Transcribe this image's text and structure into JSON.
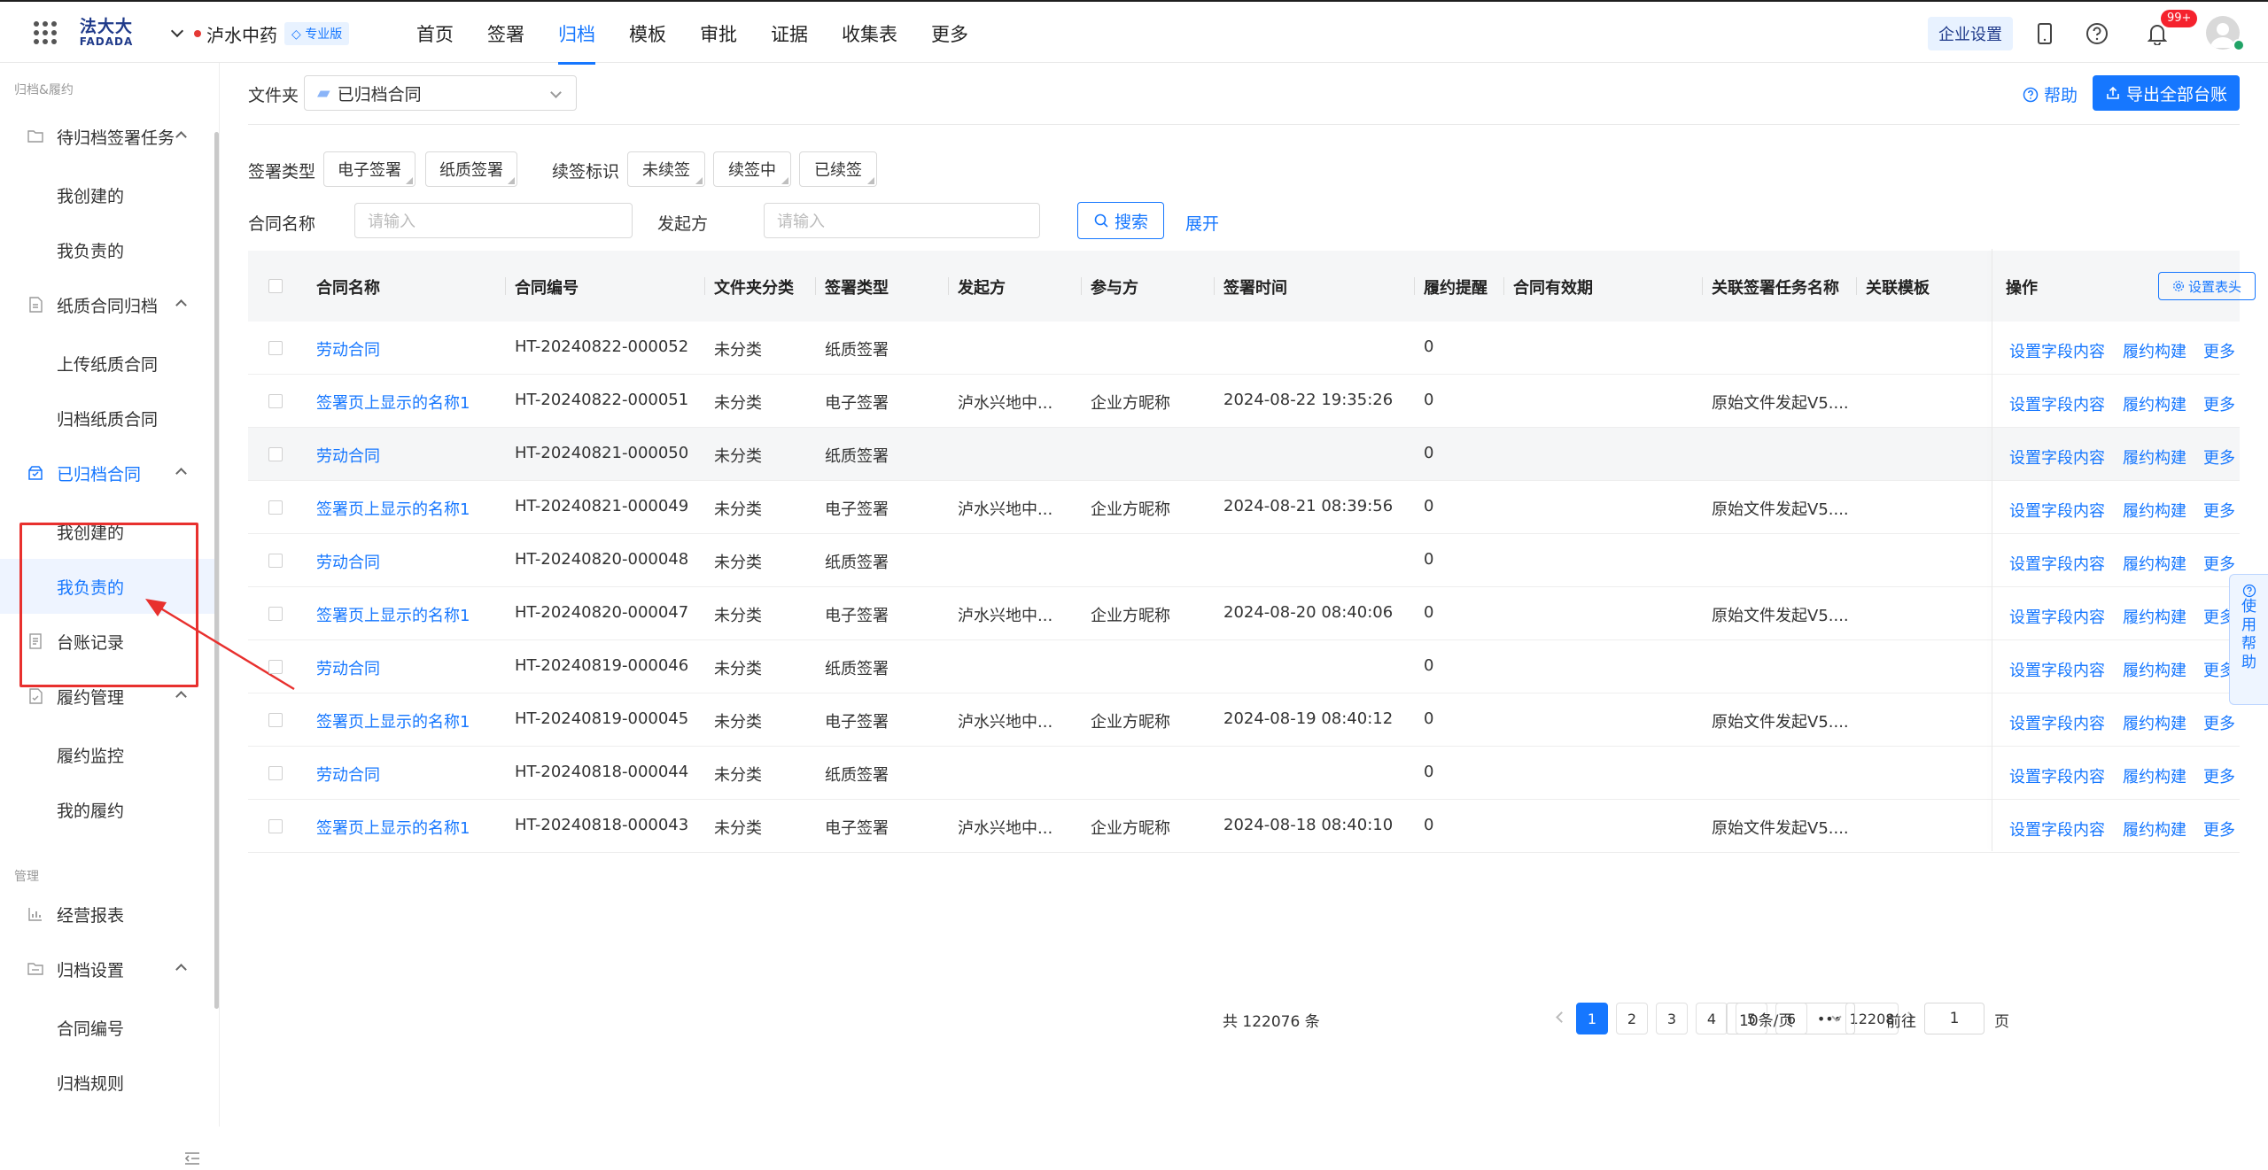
{
  "topbar": {
    "logo_line1": "法大大",
    "logo_line2": "FADADA",
    "org_name": "泸水中药",
    "org_badge": "专业版",
    "nav": [
      "首页",
      "签署",
      "归档",
      "模板",
      "审批",
      "证据",
      "收集表",
      "更多"
    ],
    "active_nav": "归档",
    "enterprise_settings": "企业设置",
    "notification_count": "99+"
  },
  "sidebar": {
    "section1": "归档&履约",
    "items": [
      {
        "label": "待归档签署任务",
        "type": "group",
        "icon": "folder-icon"
      },
      {
        "label": "我创建的",
        "type": "sub"
      },
      {
        "label": "我负责的",
        "type": "sub"
      },
      {
        "label": "纸质合同归档",
        "type": "group",
        "icon": "paper-icon"
      },
      {
        "label": "上传纸质合同",
        "type": "sub"
      },
      {
        "label": "归档纸质合同",
        "type": "sub"
      },
      {
        "label": "已归档合同",
        "type": "group",
        "icon": "archive-box-icon"
      },
      {
        "label": "我创建的",
        "type": "sub"
      },
      {
        "label": "我负责的",
        "type": "sub"
      },
      {
        "label": "台账记录",
        "type": "single",
        "icon": "ledger-icon"
      },
      {
        "label": "履约管理",
        "type": "group",
        "icon": "performance-icon"
      },
      {
        "label": "履约监控",
        "type": "sub"
      },
      {
        "label": "我的履约",
        "type": "sub"
      }
    ],
    "section2": "管理",
    "items2": [
      {
        "label": "经营报表",
        "type": "single",
        "icon": "chart-icon"
      },
      {
        "label": "归档设置",
        "type": "group",
        "icon": "settings-folder-icon"
      },
      {
        "label": "合同编号",
        "type": "sub"
      },
      {
        "label": "归档规则",
        "type": "sub"
      }
    ]
  },
  "toolbar": {
    "folder_label": "文件夹",
    "folder_value": "已归档合同",
    "help": "帮助",
    "export": "导出全部台账"
  },
  "filters": {
    "sign_type_label": "签署类型",
    "sign_types": [
      "电子签署",
      "纸质签署"
    ],
    "renew_label": "续签标识",
    "renew_tags": [
      "未续签",
      "续签中",
      "已续签"
    ],
    "contract_name_label": "合同名称",
    "contract_name_placeholder": "请输入",
    "initiator_label": "发起方",
    "initiator_placeholder": "请输入",
    "search": "搜索",
    "expand": "展开"
  },
  "table": {
    "columns": [
      "合同名称",
      "合同编号",
      "文件夹分类",
      "签署类型",
      "发起方",
      "参与方",
      "签署时间",
      "履约提醒",
      "合同有效期",
      "关联签署任务名称",
      "关联模板"
    ],
    "op_column": "操作",
    "set_columns": "设置表头",
    "ops": [
      "设置字段内容",
      "履约构建",
      "更多"
    ],
    "rows": [
      [
        "劳动合同",
        "HT-20240822-000052",
        "未分类",
        "纸质签署",
        "",
        "",
        "",
        "0",
        "",
        "",
        ""
      ],
      [
        "签署页上显示的名称1",
        "HT-20240822-000051",
        "未分类",
        "电子签署",
        "泸水兴地中...",
        "企业方昵称",
        "2024-08-22 19:35:26",
        "0",
        "",
        "原始文件发起V5....",
        ""
      ],
      [
        "劳动合同",
        "HT-20240821-000050",
        "未分类",
        "纸质签署",
        "",
        "",
        "",
        "0",
        "",
        "",
        ""
      ],
      [
        "签署页上显示的名称1",
        "HT-20240821-000049",
        "未分类",
        "电子签署",
        "泸水兴地中...",
        "企业方昵称",
        "2024-08-21 08:39:56",
        "0",
        "",
        "原始文件发起V5....",
        ""
      ],
      [
        "劳动合同",
        "HT-20240820-000048",
        "未分类",
        "纸质签署",
        "",
        "",
        "",
        "0",
        "",
        "",
        ""
      ],
      [
        "签署页上显示的名称1",
        "HT-20240820-000047",
        "未分类",
        "电子签署",
        "泸水兴地中...",
        "企业方昵称",
        "2024-08-20 08:40:06",
        "0",
        "",
        "原始文件发起V5....",
        ""
      ],
      [
        "劳动合同",
        "HT-20240819-000046",
        "未分类",
        "纸质签署",
        "",
        "",
        "",
        "0",
        "",
        "",
        ""
      ],
      [
        "签署页上显示的名称1",
        "HT-20240819-000045",
        "未分类",
        "电子签署",
        "泸水兴地中...",
        "企业方昵称",
        "2024-08-19 08:40:12",
        "0",
        "",
        "原始文件发起V5....",
        ""
      ],
      [
        "劳动合同",
        "HT-20240818-000044",
        "未分类",
        "纸质签署",
        "",
        "",
        "",
        "0",
        "",
        "",
        ""
      ],
      [
        "签署页上显示的名称1",
        "HT-20240818-000043",
        "未分类",
        "电子签署",
        "泸水兴地中...",
        "企业方昵称",
        "2024-08-18 08:40:10",
        "0",
        "",
        "原始文件发起V5....",
        ""
      ]
    ]
  },
  "pagination": {
    "total": "共 122076 条",
    "pages": [
      "1",
      "2",
      "3",
      "4",
      "5",
      "6"
    ],
    "current": "1",
    "ellipsis": "•••",
    "last": "12208",
    "page_size": "10条/页",
    "goto_label": "前往",
    "goto_value": "1",
    "goto_suffix": "页"
  },
  "float_help": [
    "使",
    "用",
    "帮",
    "助"
  ]
}
